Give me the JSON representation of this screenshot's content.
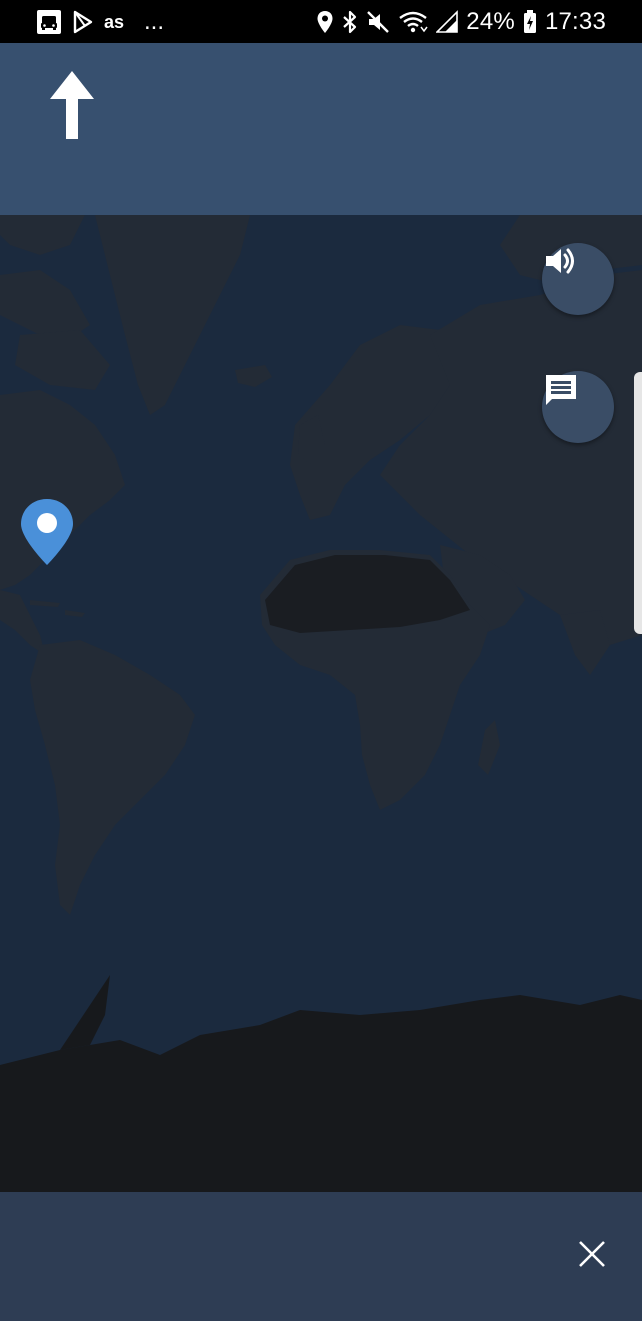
{
  "status_bar": {
    "left_text": "",
    "ellipsis": "...",
    "battery": "24%",
    "time": "17:33",
    "icons": [
      "drive-mode-icon",
      "play-store-icon",
      "lastfm-icon",
      "location-icon",
      "bluetooth-icon",
      "mute-icon",
      "wifi-icon",
      "signal-icon",
      "battery-icon"
    ]
  },
  "navigation": {
    "direction_icon": "arrow-up-icon"
  },
  "map": {
    "buttons": {
      "sound_icon": "volume-icon",
      "report_icon": "chat-icon"
    },
    "location_marker_icon": "location-pin-icon"
  },
  "bottom_panel": {
    "close_icon": "close-icon"
  },
  "colors": {
    "header": "#37506f",
    "ocean": "#1b2a3e",
    "land": "#232b36",
    "desert": "#1a1d22",
    "fab": "#3a4d66",
    "bottom": "#2e3d54",
    "pin": "#4a90d9"
  }
}
